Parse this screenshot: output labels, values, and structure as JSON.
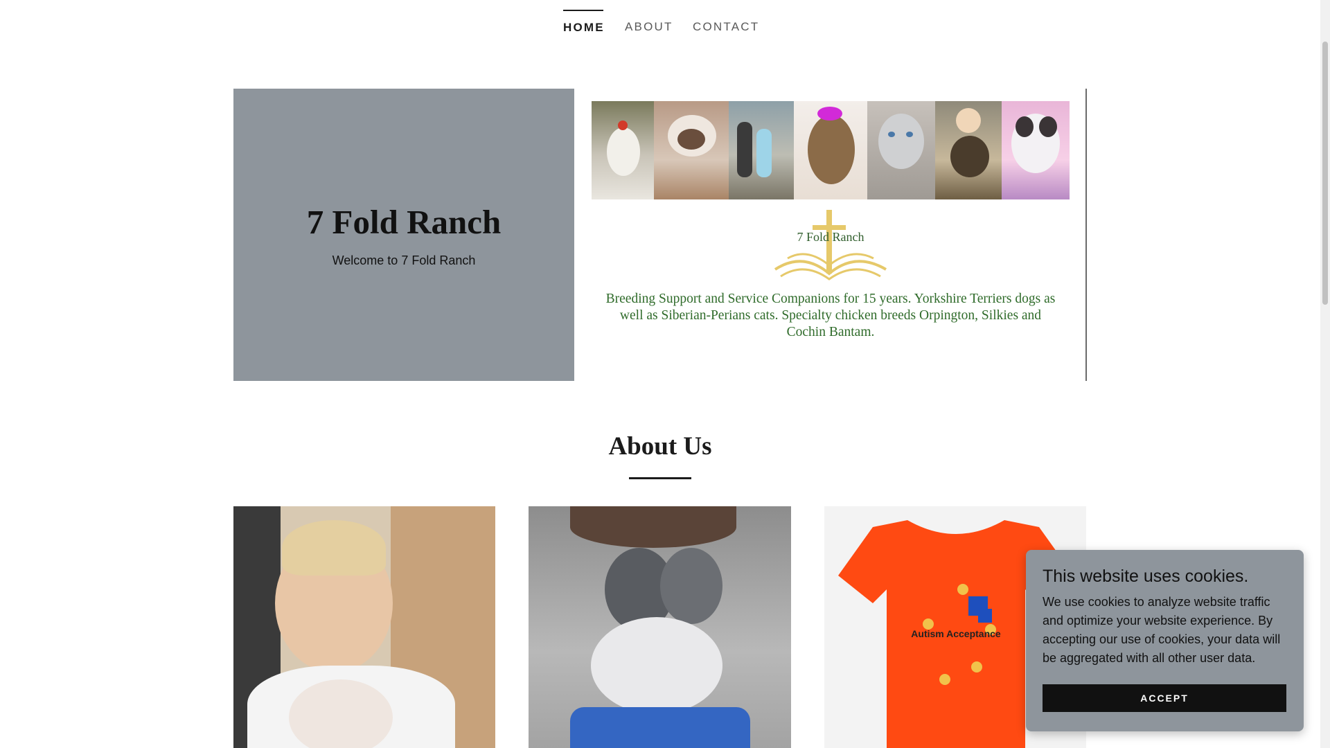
{
  "nav": {
    "items": [
      {
        "label": "HOME",
        "active": true
      },
      {
        "label": "ABOUT",
        "active": false
      },
      {
        "label": "CONTACT",
        "active": false
      }
    ]
  },
  "hero": {
    "title": "7 Fold Ranch",
    "subtitle": "Welcome to 7 Fold Ranch",
    "banner": {
      "logo_text": "7 Fold Ranch",
      "description": "Breeding Support and Service Companions for 15 years. Yorkshire Terriers dogs as well as Siberian-Perians cats. Specialty chicken breeds Orpington, Silkies and Cochin Bantam."
    }
  },
  "about": {
    "title": "About Us"
  },
  "cookie": {
    "title": "This website uses cookies.",
    "text": "We use cookies to analyze website traffic and optimize your website experience. By accepting our use of cookies, your data will be aggregated with all other user data.",
    "accept_label": "ACCEPT"
  },
  "colors": {
    "hero_panel": "#8e959c",
    "banner_text": "#2f6b2a",
    "cookie_bg": "#8e959c",
    "tshirt": "#ff4a12"
  },
  "images": {
    "shirt_text": "Autism Acceptance"
  }
}
